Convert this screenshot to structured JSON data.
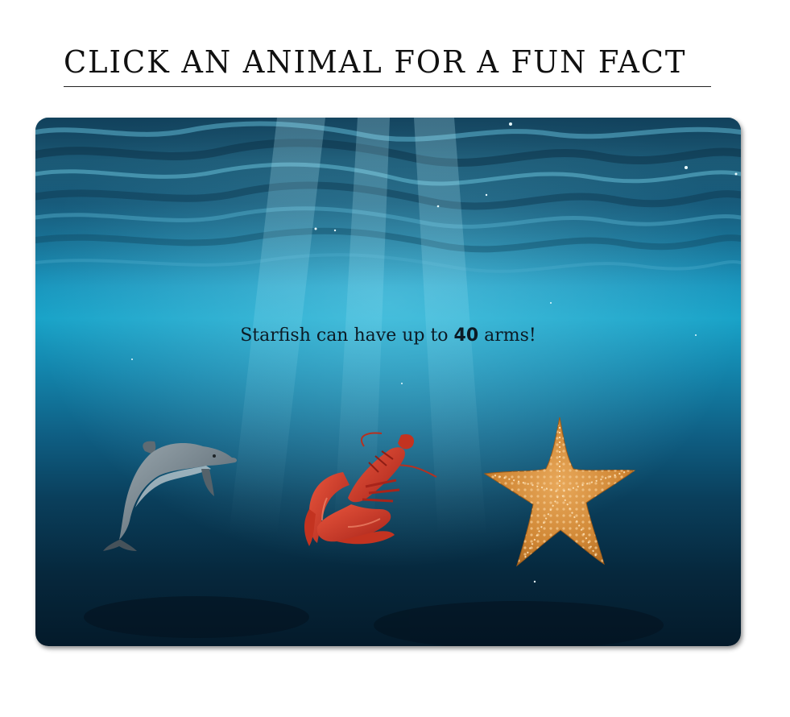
{
  "page": {
    "title": "Click an animal for a fun fact"
  },
  "fact": {
    "prefix": "Starfish can have up to ",
    "number": "40",
    "suffix": " arms!"
  },
  "animals": [
    {
      "name": "Dolphin",
      "icon": "dolphin-icon"
    },
    {
      "name": "Lobster",
      "icon": "lobster-icon"
    },
    {
      "name": "Starfish",
      "icon": "starfish-icon"
    }
  ],
  "colors": {
    "water_top": "#2e86a6",
    "water_mid": "#19a3c8",
    "water_bottom": "#041a2a",
    "dolphin": "#6f7f88",
    "lobster": "#c8321f",
    "starfish": "#d9913f"
  }
}
